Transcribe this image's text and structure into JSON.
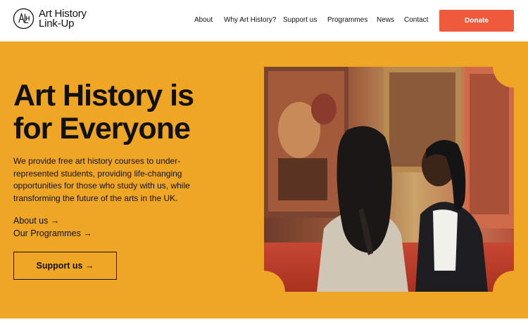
{
  "header": {
    "logo_line1": "Art History",
    "logo_line2": "Link-Up",
    "nav": {
      "about": "About",
      "why": "Why Art History?",
      "support": "Support us",
      "programmes": "Programmes",
      "news": "News",
      "contact": "Contact"
    },
    "donate_label": "Donate"
  },
  "hero": {
    "title_line1": "Art History is",
    "title_line2": "for Everyone",
    "description": "We provide free art history courses to under-represented students, providing life-changing opportunities for those who study with us, while transforming the future of the arts in the UK.",
    "link_about": "About us →",
    "link_programmes": "Our Programmes →",
    "support_button": "Support us →",
    "image_alt": "Two students looking at paintings in a gallery"
  },
  "colors": {
    "hero_background": "#eea624",
    "donate_button": "#f05a3c",
    "text": "#111111"
  },
  "icons": {
    "logo": "alh-monogram-icon"
  }
}
